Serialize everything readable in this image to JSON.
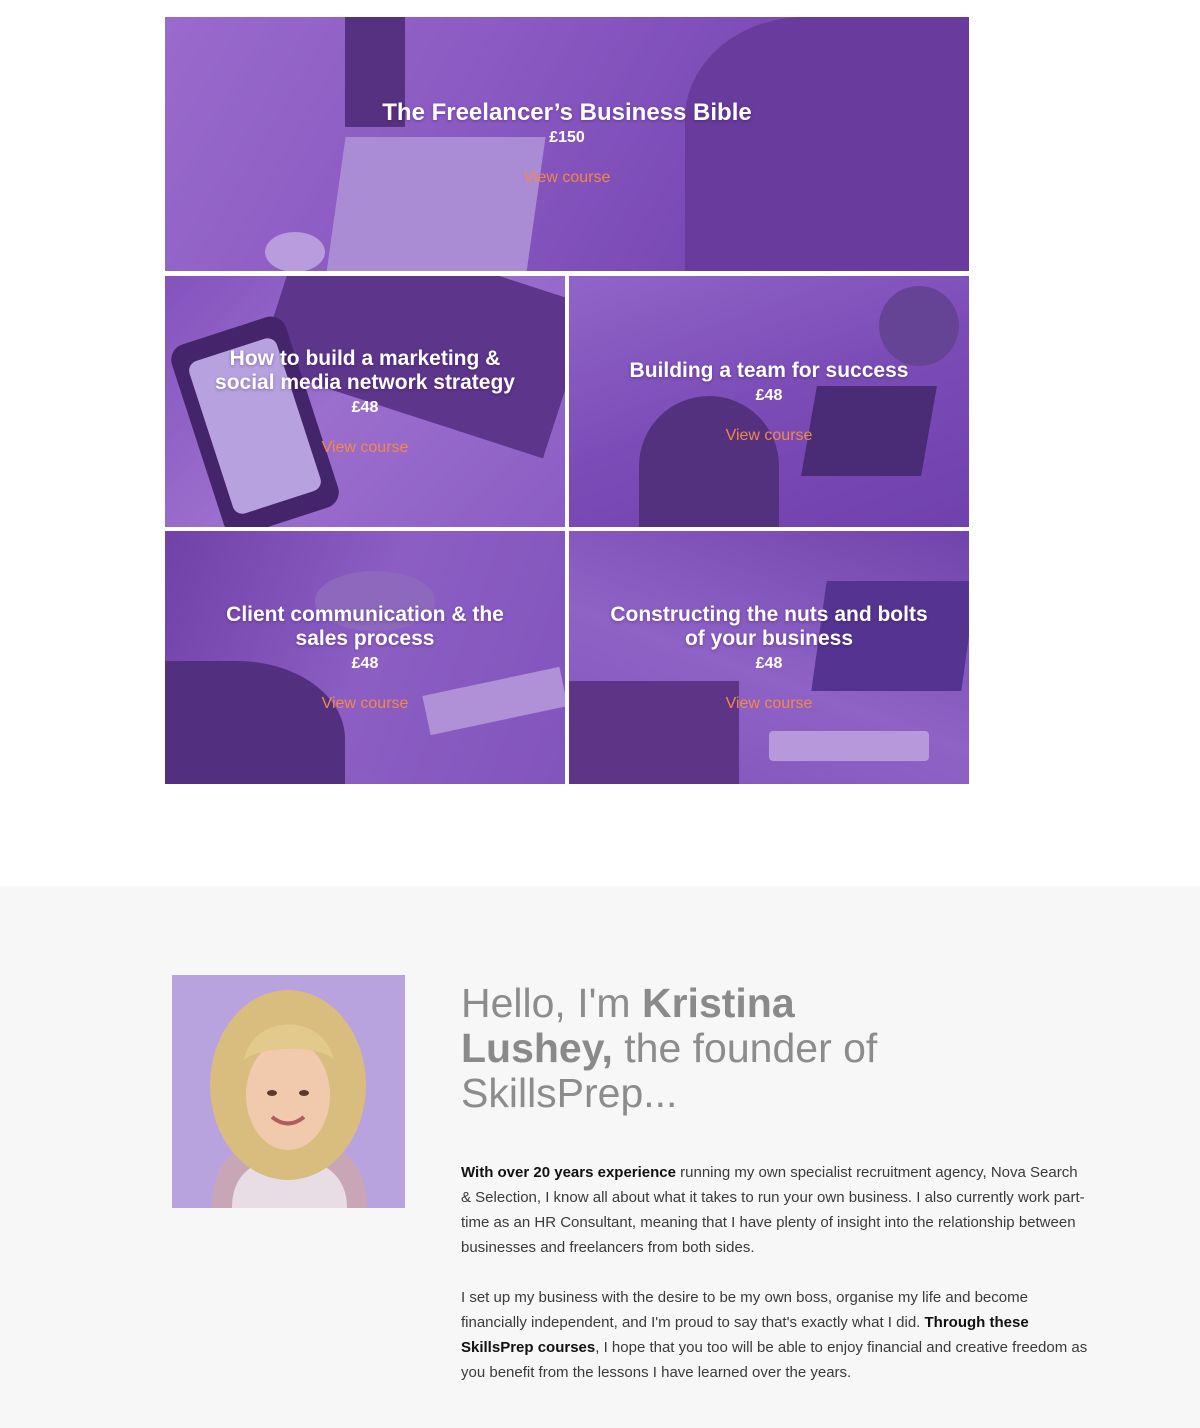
{
  "courses": [
    {
      "title": "The Freelancer’s Business Bible",
      "price": "£150",
      "link_label": "View course"
    },
    {
      "title": "How to build a marketing & social media network strategy",
      "price": "£48",
      "link_label": "View course"
    },
    {
      "title": "Building a team for success",
      "price": "£48",
      "link_label": "View course"
    },
    {
      "title": "Client communication & the sales process",
      "price": "£48",
      "link_label": "View course"
    },
    {
      "title": "Constructing the nuts and bolts of your business",
      "price": "£48",
      "link_label": "View course"
    }
  ],
  "about": {
    "heading_prefix": "Hello, I'm ",
    "heading_name": "Kristina Lushey,",
    "heading_suffix": " the founder of SkillsPrep...",
    "p1_bold": "With over 20 years experience",
    "p1_rest": " running my own specialist recruitment agency, Nova Search & Selection, I know all about what it takes to run your own business. I also currently work part-time as an HR Consultant, meaning that I have plenty of insight into the relationship between businesses and freelancers from both sides.",
    "p2_start": "I set up my business with the desire to be my own boss, organise my life and become financially independent, and I'm proud to say that's exactly what I did. ",
    "p2_bold": "Through these SkillsPrep courses",
    "p2_end": ", I hope that you too will be able to enjoy financial and creative freedom as you benefit from the lessons I have learned over the years."
  },
  "colors": {
    "overlay": "#7a3cbe",
    "link": "#f2884a",
    "section_bg": "#f7f7f7",
    "heading": "#8c8c8c"
  }
}
